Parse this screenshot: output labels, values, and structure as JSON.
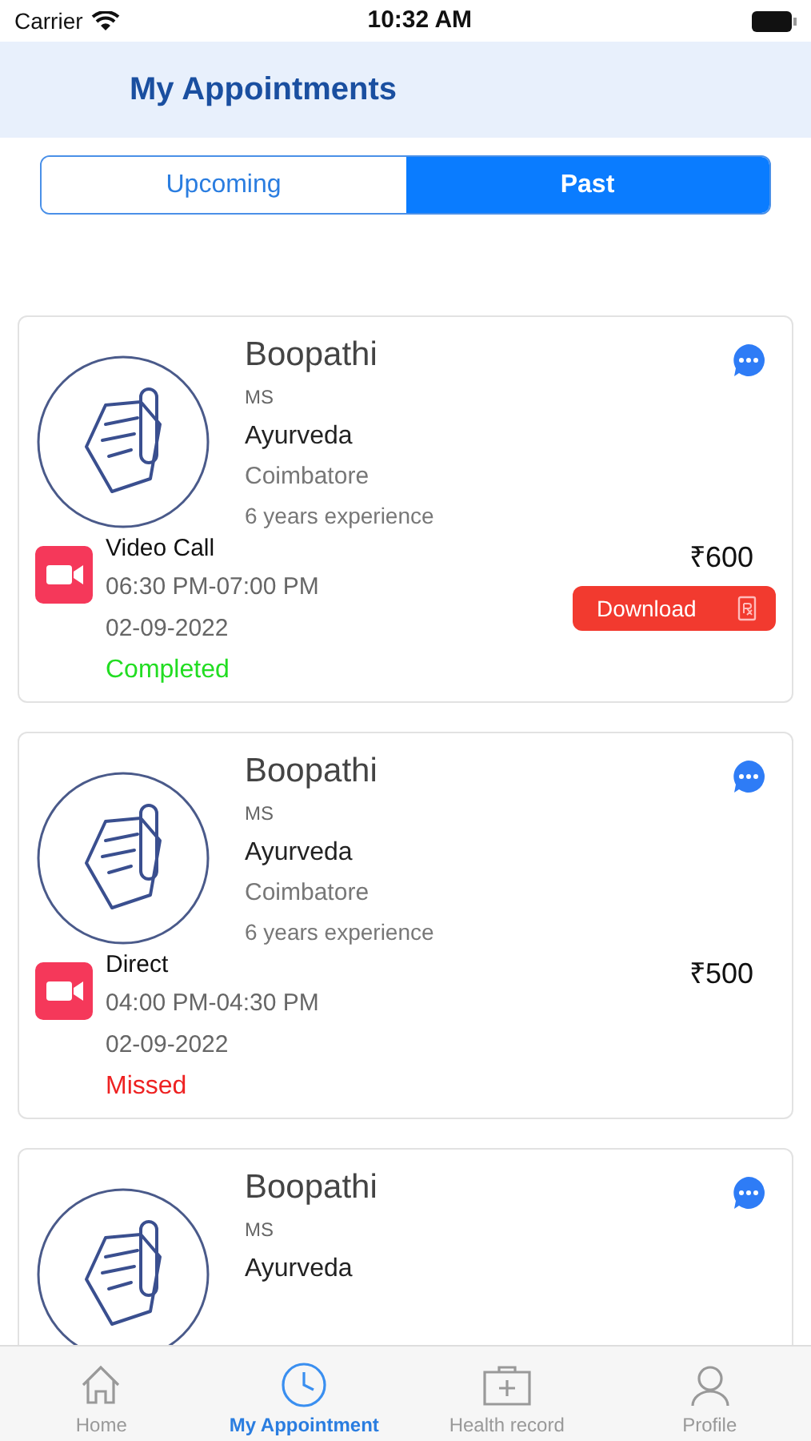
{
  "status_bar": {
    "carrier": "Carrier",
    "time": "10:32 AM"
  },
  "header": {
    "title": "My Appointments"
  },
  "tabs": [
    {
      "label": "Upcoming",
      "selected": false
    },
    {
      "label": "Past",
      "selected": true
    }
  ],
  "appointments": [
    {
      "name": "Boopathi",
      "degree": "MS",
      "specialty": "Ayurveda",
      "city": "Coimbatore",
      "experience": "6 years experience",
      "mode": "Video Call",
      "time": "06:30 PM-07:00 PM",
      "date": "02-09-2022",
      "status": {
        "text": "Completed",
        "kind": "completed"
      },
      "price": "₹600",
      "download": "Download"
    },
    {
      "name": "Boopathi",
      "degree": "MS",
      "specialty": "Ayurveda",
      "city": "Coimbatore",
      "experience": "6 years experience",
      "mode": "Direct",
      "time": "04:00 PM-04:30 PM",
      "date": "02-09-2022",
      "status": {
        "text": "Missed",
        "kind": "missed"
      },
      "price": "₹500"
    },
    {
      "name": "Boopathi",
      "degree": "MS",
      "specialty": "Ayurveda"
    }
  ],
  "tab_bar": [
    {
      "label": "Home",
      "kind": "home",
      "selected": false
    },
    {
      "label": "My Appointment",
      "kind": "clock",
      "selected": true
    },
    {
      "label": "Health record",
      "kind": "record",
      "selected": false
    },
    {
      "label": "Profile",
      "kind": "profile",
      "selected": false
    }
  ]
}
